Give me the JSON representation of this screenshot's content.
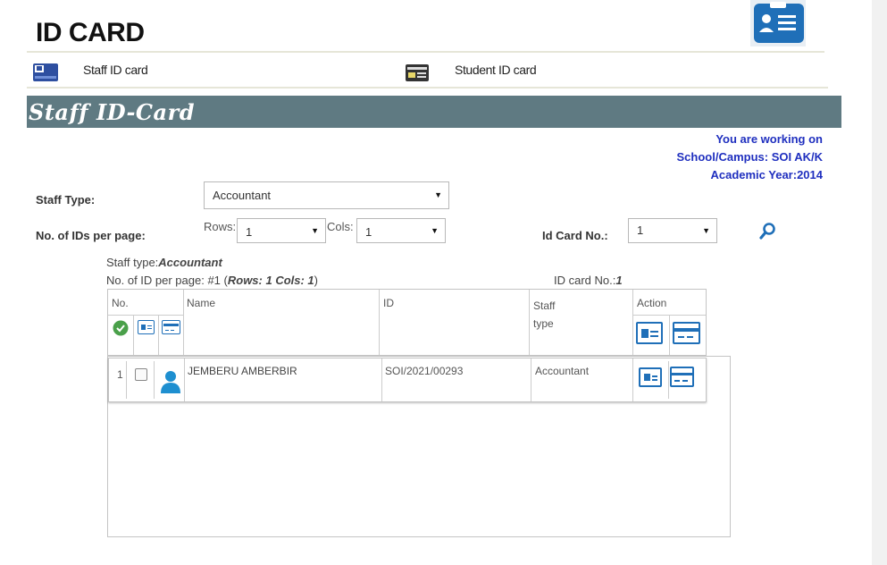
{
  "header": {
    "title": "ID CARD",
    "icon": "id-badge-icon"
  },
  "nav": {
    "staff_label": "Staff ID card",
    "student_label": "Student ID card"
  },
  "banner": {
    "title": "Staff ID-Card"
  },
  "context": {
    "line1": "You are working on",
    "line2": "School/Campus: SOI AK/K",
    "line3": "Academic Year:2014"
  },
  "form": {
    "staff_type_label": "Staff Type:",
    "staff_type_value": "Accountant",
    "ids_per_page_label": "No. of IDs per page:",
    "rows_label": "Rows:",
    "rows_value": "1",
    "cols_label": "Cols:",
    "cols_value": "1",
    "id_card_no_label": "Id Card No.:",
    "id_card_no_value": "1"
  },
  "summary": {
    "staff_type_prefix": "Staff type:",
    "staff_type_value": "Accountant",
    "ids_prefix": "No. of ID per page: #1 (",
    "ids_detail": "Rows: 1 Cols: 1",
    "ids_suffix": ")",
    "card_no_prefix": "ID card No.:",
    "card_no_value": "1"
  },
  "table": {
    "headers": {
      "no": "No.",
      "name": "Name",
      "id": "ID",
      "staff_type_line1": "Staff",
      "staff_type_line2": "type",
      "action": "Action"
    },
    "rows": [
      {
        "no": "1",
        "name": "JEMBERU AMBERBIR",
        "id": "SOI/2021/00293",
        "staff_type": "Accountant"
      }
    ]
  },
  "colors": {
    "banner": "#5f7a82",
    "accent": "#1f6fb8",
    "context_text": "#1f2fbf",
    "check_green": "#4aa04a"
  }
}
